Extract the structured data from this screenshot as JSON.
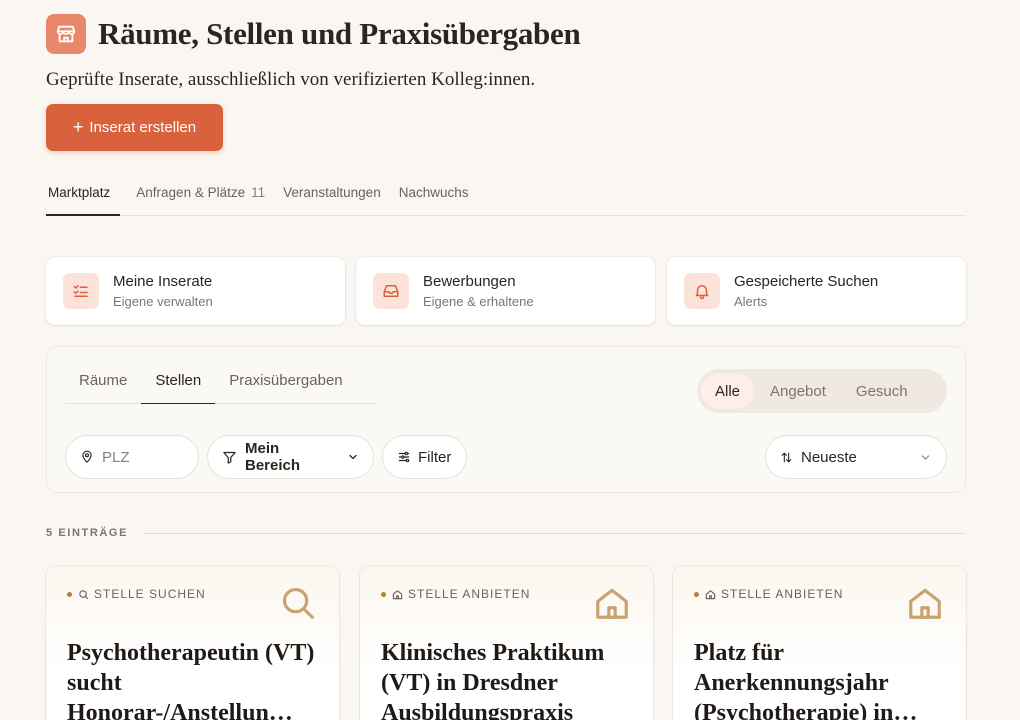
{
  "header": {
    "title": "Räume, Stellen und Praxisübergaben",
    "subtitle": "Geprüfte Inserate, ausschließlich von verifizierten Kolleg:innen.",
    "icon": "storefront-icon",
    "create_button": "Inserat erstellen"
  },
  "top_tabs": [
    {
      "label": "Marktplatz",
      "active": true
    },
    {
      "label": "Anfragen & Plätze",
      "count": "11"
    },
    {
      "label": "Veranstaltungen"
    },
    {
      "label": "Nachwuchs"
    }
  ],
  "quick_cards": [
    {
      "title": "Meine Inserate",
      "sub": "Eigene verwalten",
      "icon": "checklist-icon"
    },
    {
      "title": "Bewerbungen",
      "sub": "Eigene & erhaltene",
      "icon": "inbox-icon"
    },
    {
      "title": "Gespeicherte Suchen",
      "sub": "Alerts",
      "icon": "bell-icon"
    }
  ],
  "filters": {
    "sub_tabs": [
      "Räume",
      "Stellen",
      "Praxisübergaben"
    ],
    "active_sub_tab": "Stellen",
    "segment": [
      "Alle",
      "Angebot",
      "Gesuch"
    ],
    "active_segment": "Alle",
    "plz_placeholder": "PLZ",
    "area": "Mein Bereich",
    "filter": "Filter",
    "sort": "Neueste"
  },
  "entries": {
    "label": "5 EINTRÄGE",
    "cards": [
      {
        "tag": "STELLE SUCHEN",
        "title": "Psychotherapeutin (VT) sucht Honorar-/Anstellun…",
        "icon": "search-icon"
      },
      {
        "tag": "STELLE ANBIETEN",
        "title": "Klinisches Praktikum (VT) in Dresdner Ausbildungspraxis",
        "icon": "home-icon"
      },
      {
        "tag": "STELLE ANBIETEN",
        "title": "Platz für Anerkennungsjahr (Psychotherapie) in…",
        "icon": "home-icon"
      }
    ]
  },
  "colors": {
    "accent": "#d9623c",
    "accent_soft": "#fbe3da",
    "background": "#faf7f2",
    "tag_dot": "#b0813c",
    "card_icon": "#c9a36f"
  }
}
